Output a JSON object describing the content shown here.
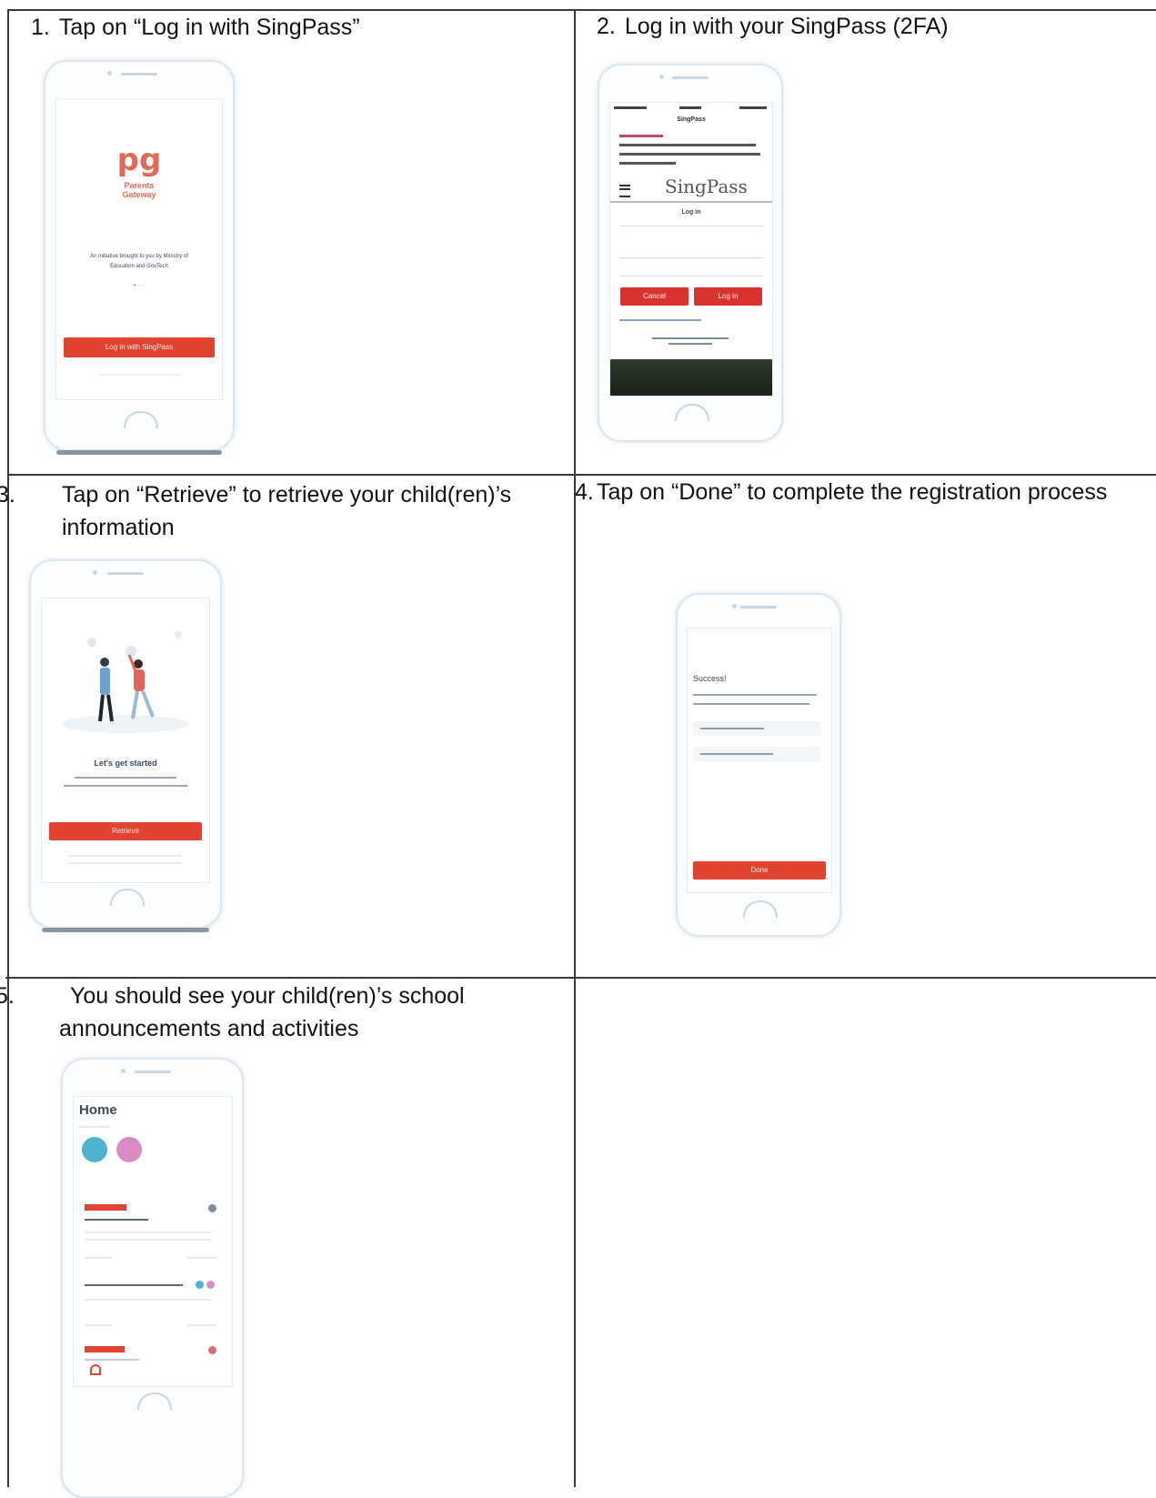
{
  "steps": [
    {
      "num": "1.",
      "text": "Tap on “Log in with SingPass”"
    },
    {
      "num": "2.",
      "text": "Log in with your SingPass (2FA)"
    },
    {
      "num": "3.",
      "text": "Tap on “Retrieve” to retrieve your child(ren)’s information"
    },
    {
      "num": "4.",
      "text": "Tap on “Done” to complete the registration process"
    },
    {
      "num": "5.",
      "text": "You should see your child(ren)’s school announcements and activities"
    }
  ],
  "screen1": {
    "logo_mark": "pg",
    "logo_line1": "Parents",
    "logo_line2": "Gateway",
    "tagline": "An initiative brought to you by Ministry of Education and GovTech",
    "button": "Log in with SingPass"
  },
  "screen2": {
    "title": "SingPass",
    "logo": "SingPass",
    "login_label": "Log in",
    "cancel": "Cancel",
    "login_button": "Log in"
  },
  "screen3": {
    "heading": "Let's get started",
    "button": "Retrieve"
  },
  "screen4": {
    "heading": "Success!",
    "button": "Done"
  },
  "screen5": {
    "title": "Home"
  },
  "colors": {
    "accent_red": "#e0432f",
    "avatar_teal": "#4fb3cf",
    "avatar_pink": "#d98bc4"
  }
}
